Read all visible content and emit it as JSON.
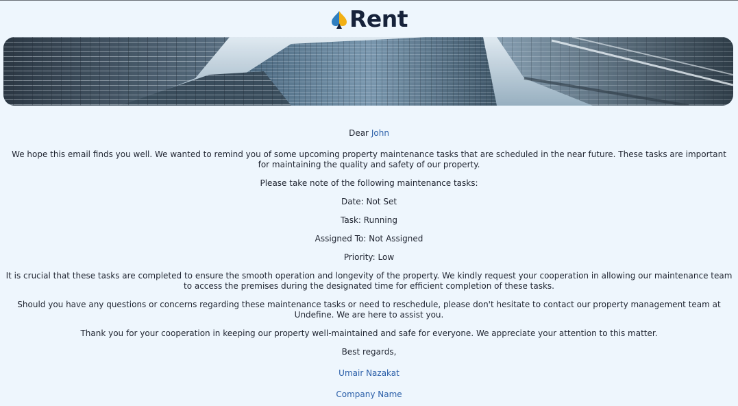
{
  "header": {
    "brand_name": "Rent",
    "logo_icon": "spade-drop-icon",
    "brand_colors": {
      "text": "#16223a",
      "accent_blue": "#2f7fc0",
      "accent_gold": "#f2b015"
    }
  },
  "email": {
    "greeting_prefix": "Dear",
    "recipient_name": "John",
    "intro": "We hope this email finds you well. We wanted to remind you of some upcoming property maintenance tasks that are scheduled in the near future. These tasks are important for maintaining the quality and safety of our property.",
    "list_intro": "Please take note of the following maintenance tasks:",
    "task_date": "Date: Not Set",
    "task_name": "Task: Running",
    "task_assigned": "Assigned To: Not Assigned",
    "task_priority": "Priority: Low",
    "cooperation": "It is crucial that these tasks are completed to ensure the smooth operation and longevity of the property. We kindly request your cooperation in allowing our maintenance team to access the premises during the designated time for efficient completion of these tasks.",
    "questions": "Should you have any questions or concerns regarding these maintenance tasks or need to reschedule, please don't hesitate to contact our property management team at Undefine. We are here to assist you.",
    "thanks": "Thank you for your cooperation in keeping our property well-maintained and safe for everyone. We appreciate your attention to this matter.",
    "closing": "Best regards,",
    "sender_name": "Umair Nazakat",
    "company_name": "Company Name"
  }
}
